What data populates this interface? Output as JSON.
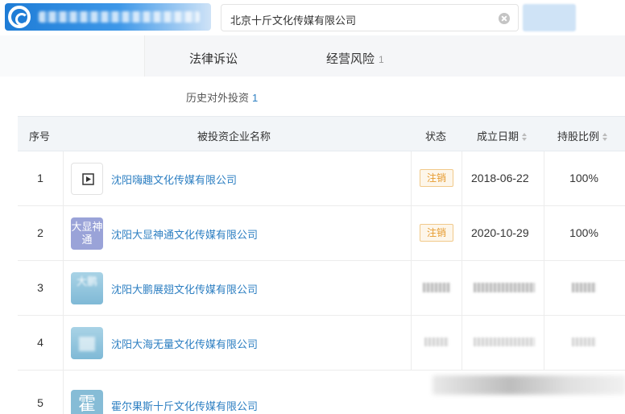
{
  "header": {
    "search_value": "北京十斤文化传媒有限公司"
  },
  "tabs": [
    {
      "label": "法律诉讼",
      "count": ""
    },
    {
      "label": "经营风险",
      "count": "1"
    }
  ],
  "section": {
    "title": "历史对外投资",
    "count": "1"
  },
  "table": {
    "columns": {
      "index": "序号",
      "name": "被投资企业名称",
      "status": "状态",
      "date": "成立日期",
      "ratio": "持股比例"
    },
    "rows": [
      {
        "index": "1",
        "logo": "play-icon",
        "logo_text": "",
        "logo_color": "#ffffff",
        "name": "沈阳嗨趣文化传媒有限公司",
        "status": "注销",
        "date": "2018-06-22",
        "ratio": "100%"
      },
      {
        "index": "2",
        "logo": "text-logo",
        "logo_text": "大显神通",
        "logo_color": "#9aa3d8",
        "name": "沈阳大显神通文化传媒有限公司",
        "status": "注销",
        "date": "2020-10-29",
        "ratio": "100%"
      },
      {
        "index": "3",
        "logo": "text-logo",
        "logo_text": "大鹏",
        "logo_color": "#8fc3dc",
        "name": "沈阳大鹏展翅文化传媒有限公司",
        "status": "",
        "date": "",
        "ratio": ""
      },
      {
        "index": "4",
        "logo": "text-logo",
        "logo_text": "",
        "logo_color": "#8fc3dc",
        "name": "沈阳大海无量文化传媒有限公司",
        "status": "",
        "date": "",
        "ratio": ""
      },
      {
        "index": "5",
        "logo": "text-logo",
        "logo_text": "霍",
        "logo_color": "#8fc3dc",
        "name": "霍尔果斯十斤文化传媒有限公司",
        "status": "",
        "date": "",
        "ratio": ""
      }
    ]
  }
}
